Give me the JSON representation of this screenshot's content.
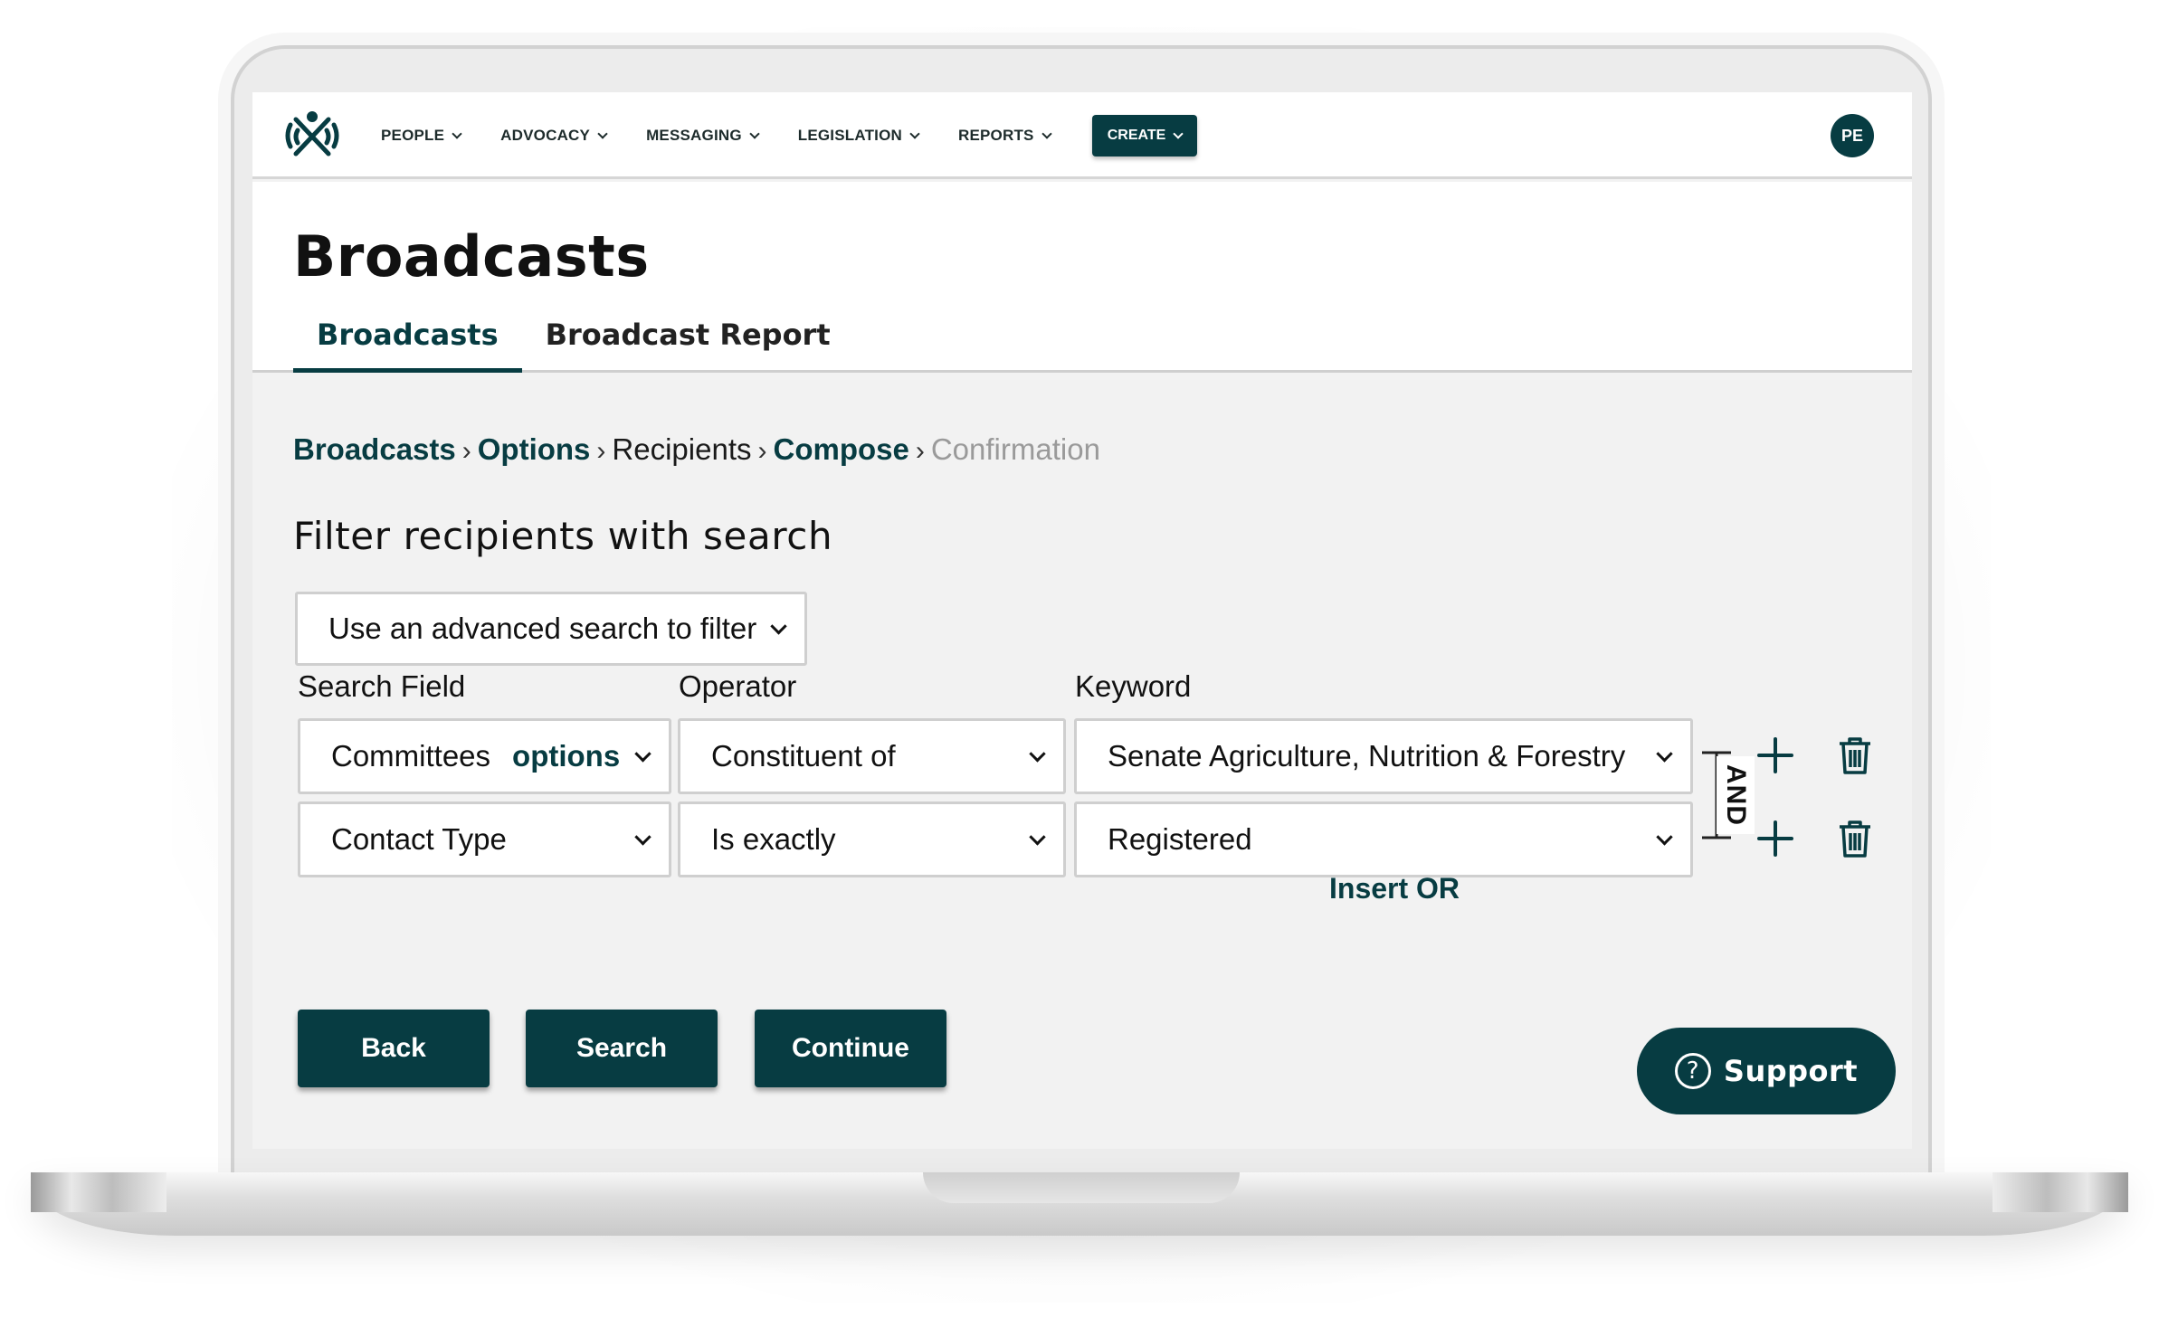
{
  "nav": {
    "items": [
      {
        "label": "PEOPLE"
      },
      {
        "label": "ADVOCACY"
      },
      {
        "label": "MESSAGING"
      },
      {
        "label": "LEGISLATION"
      },
      {
        "label": "REPORTS"
      }
    ],
    "create_label": "CREATE",
    "avatar_initials": "PE"
  },
  "header": {
    "title": "Broadcasts",
    "tabs": [
      {
        "label": "Broadcasts",
        "active": true
      },
      {
        "label": "Broadcast Report",
        "active": false
      }
    ]
  },
  "breadcrumb": {
    "items": [
      "Broadcasts",
      "Options",
      "Recipients",
      "Compose",
      "Confirmation"
    ],
    "separator": "›"
  },
  "filter": {
    "title": "Filter recipients with search",
    "mode_select": "Use an advanced search to filter",
    "labels": {
      "search_field": "Search Field",
      "operator": "Operator",
      "keyword": "Keyword"
    },
    "rows": [
      {
        "field": "Committees",
        "field_link": "options",
        "operator": "Constituent of",
        "keyword": "Senate Agriculture, Nutrition & Forestry"
      },
      {
        "field": "Contact Type",
        "field_link": "",
        "operator": "Is exactly",
        "keyword": "Registered"
      }
    ],
    "join_label": "AND",
    "insert_or_label": "Insert OR"
  },
  "actions": {
    "back": "Back",
    "search": "Search",
    "continue": "Continue",
    "support": "Support",
    "support_icon_glyph": "?"
  },
  "colors": {
    "brand": "#073c42",
    "background": "#f2f2f2",
    "header_bg": "#ffffff"
  }
}
